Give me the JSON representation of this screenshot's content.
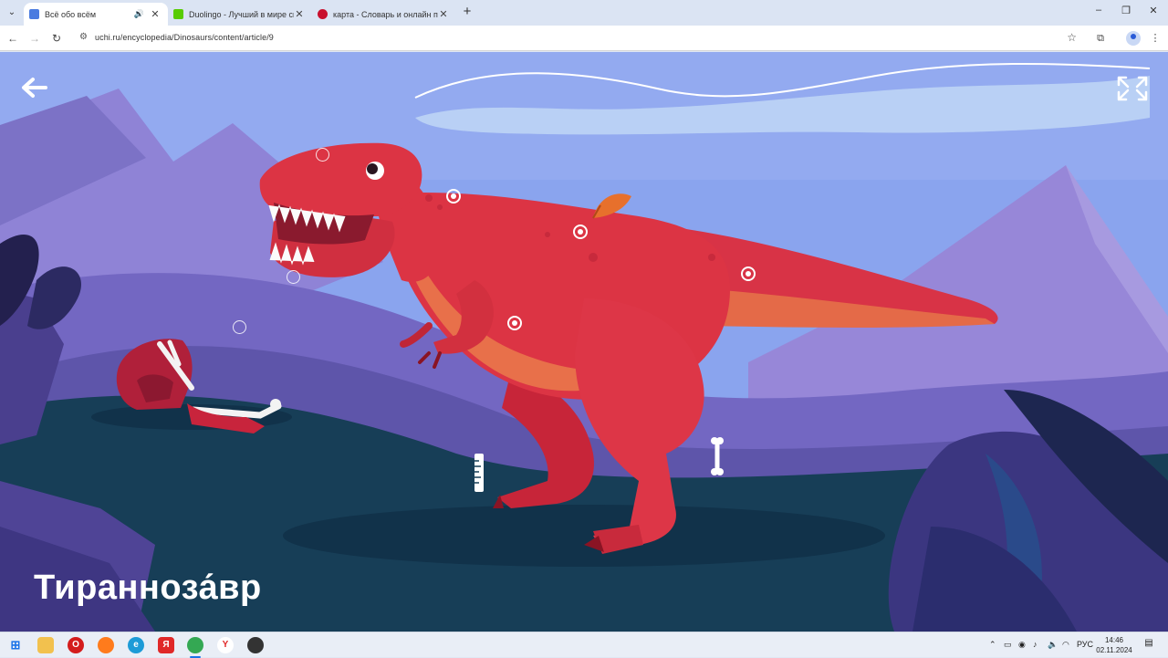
{
  "browser": {
    "tabs": [
      {
        "title": "Всё обо всём",
        "active": true,
        "audio": true,
        "favicon_color": "#4a7be0"
      },
      {
        "title": "Duolingo - Лучший в мире сп",
        "active": false,
        "audio": false,
        "favicon_color": "#58cc02"
      },
      {
        "title": "карта - Словарь и онлайн пер",
        "active": false,
        "audio": false,
        "favicon_color": "#c8102e"
      }
    ],
    "new_tab_label": "+",
    "url": "uchi.ru/encyclopedia/Dinosaurs/content/article/9"
  },
  "page": {
    "title": "Тиранноза́вр",
    "back_icon": "arrow-left-icon",
    "fullscreen_icon": "fullscreen-icon"
  },
  "colors": {
    "sky": "#8aa6f0",
    "dino_red": "#dc3444",
    "dino_belly": "#e8704a",
    "ground": "#163c55"
  },
  "taskbar": {
    "language": "РУС",
    "time": "14:46",
    "date": "02.11.2024",
    "apps": [
      "windows-icon",
      "file-explorer-icon",
      "opera-icon",
      "firefox-icon",
      "edge-icon",
      "yandex-icon",
      "chrome-icon",
      "yandex-browser-icon",
      "obs-icon"
    ]
  }
}
